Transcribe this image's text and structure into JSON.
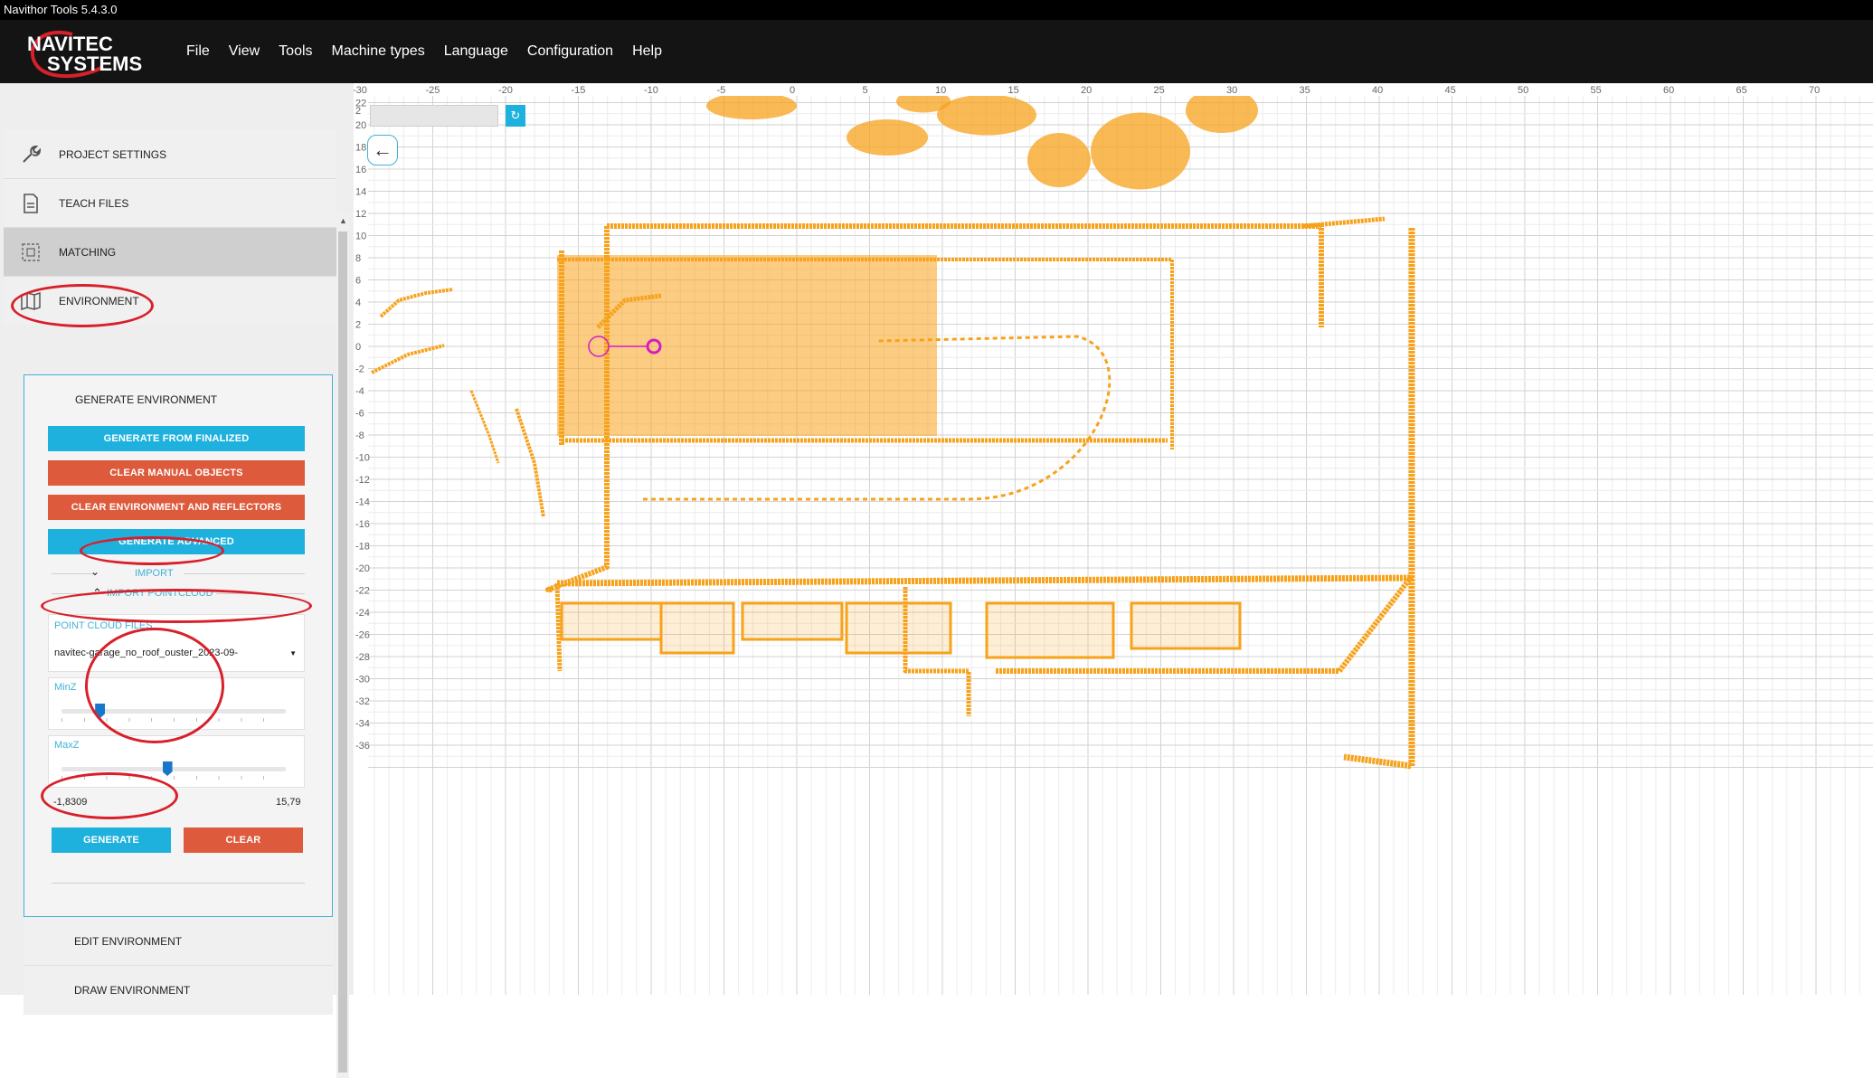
{
  "window": {
    "title": "Navithor Tools 5.4.3.0"
  },
  "brand": {
    "line1": "NAVITEC",
    "line2": "SYSTEMS"
  },
  "menu": [
    "File",
    "View",
    "Tools",
    "Machine types",
    "Language",
    "Configuration",
    "Help"
  ],
  "sidebar": {
    "items": [
      {
        "label": "PROJECT SETTINGS",
        "icon": "wrench-icon"
      },
      {
        "label": "TEACH FILES",
        "icon": "document-icon"
      },
      {
        "label": "MATCHING",
        "icon": "matching-icon"
      },
      {
        "label": "ENVIRONMENT",
        "icon": "map-icon"
      }
    ],
    "environment": {
      "generate_title": "GENERATE ENVIRONMENT",
      "btn_generate_finalized": "GENERATE FROM FINALIZED",
      "btn_clear_manual": "CLEAR MANUAL OBJECTS",
      "btn_clear_env": "CLEAR ENVIRONMENT AND REFLECTORS",
      "btn_generate_advanced": "GENERATE ADVANCED",
      "import_label": "IMPORT",
      "import_pointcloud_label": "IMPORT POINTCLOUD",
      "point_cloud_files_label": "POINT CLOUD FILES",
      "point_cloud_file": "navitec-garage_no_roof_ouster_2023-09-",
      "minz_label": "MinZ",
      "maxz_label": "MaxZ",
      "range_min": "-1,8309",
      "range_max": "15,79",
      "minz_level": 0.17,
      "maxz_level": 0.47,
      "btn_generate": "GENERATE",
      "btn_clear": "CLEAR",
      "edit_environment": "EDIT ENVIRONMENT",
      "draw_environment": "DRAW ENVIRONMENT"
    }
  },
  "map": {
    "x_ticks": [
      "-30",
      "-25",
      "-20",
      "-15",
      "-10",
      "-5",
      "0",
      "5",
      "10",
      "15",
      "20",
      "25",
      "30",
      "35",
      "40",
      "45",
      "50",
      "55",
      "60",
      "65",
      "70"
    ],
    "y_ticks": [
      "22",
      "20",
      "18",
      "16",
      "14",
      "12",
      "10",
      "8",
      "6",
      "4",
      "2",
      "0",
      "-2",
      "-4",
      "-6",
      "-8",
      "-10",
      "-12",
      "-14",
      "-16",
      "-18",
      "-20",
      "-22",
      "-24",
      "-26",
      "-28",
      "-30",
      "-32",
      "-34",
      "-36"
    ],
    "y_top_tick": "2",
    "pointcloud_color": "#f7a21b",
    "annotation_color": "#d8202a",
    "marker_color": "#d61cc5"
  },
  "colors": {
    "accent_blue": "#1fb1de",
    "accent_red": "#dd5a3c"
  }
}
